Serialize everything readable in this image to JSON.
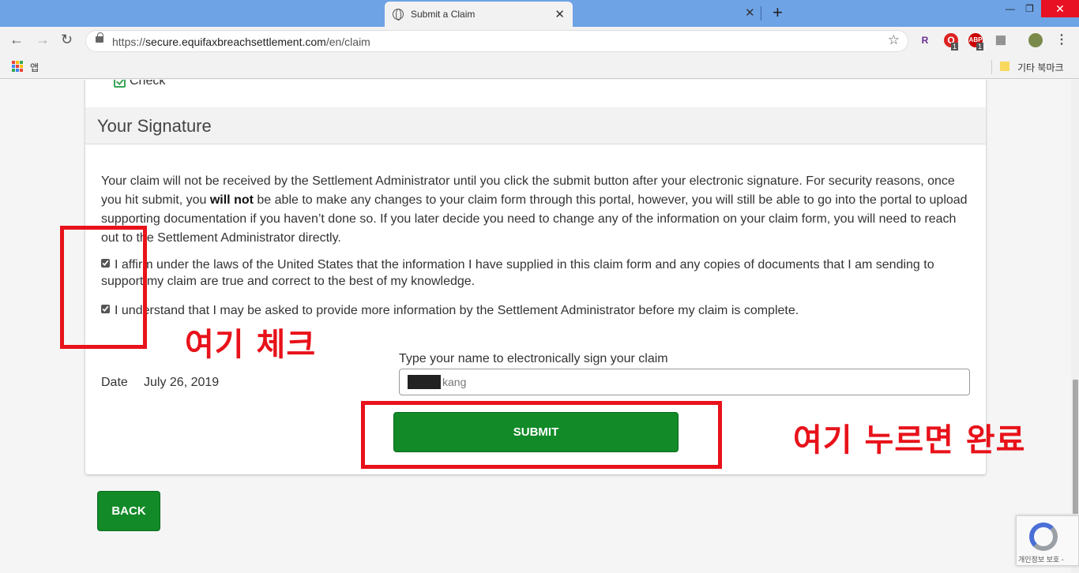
{
  "browser": {
    "tab_title": "Submit a Claim",
    "tab_close": "✕",
    "new_tab": "+",
    "url_prefix": "https://",
    "url_domain": "secure.equifaxbreachsettlement.com",
    "url_path": "/en/claim",
    "bookmarks_apps": "앱",
    "bookmarks_other": "기타 북마크",
    "ext_badges": [
      "1",
      "1"
    ]
  },
  "page": {
    "payment_option": "Check",
    "section_title": "Your Signature",
    "notice_part1": "Your claim will not be received by the Settlement Administrator until you click the submit button after your electronic signature. For security reasons, once you hit submit, you ",
    "notice_bold": "will not",
    "notice_part2": " be able to make any changes to your claim form through this portal, however, you will still be able to go into the portal to upload supporting documentation if you haven’t done so. If you later decide you need to change any of the information on your claim form, you will need to reach out to the Settlement Administrator directly.",
    "affirm1": "I affirm under the laws of the United States that the information I have supplied in this claim form and any copies of documents that I am sending to support my claim are true and correct to the best of my knowledge.",
    "affirm2": "I understand that I may be asked to provide more information by the Settlement Administrator before my claim is complete.",
    "date_label": "Date",
    "date_value": "July 26, 2019",
    "sign_label": "Type your name to electronically sign your claim",
    "sign_value": "kang",
    "submit_label": "SUBMIT",
    "back_label": "BACK"
  },
  "annotations": {
    "check_here": "여기 체크",
    "press_to_finish": "여기 누르면 완료",
    "color": "#e8121a"
  },
  "recaptcha": {
    "privacy_text": "개인정보 보호 -"
  },
  "colors": {
    "tabstrip": "#6ea3e6",
    "button_green": "#128a28"
  }
}
